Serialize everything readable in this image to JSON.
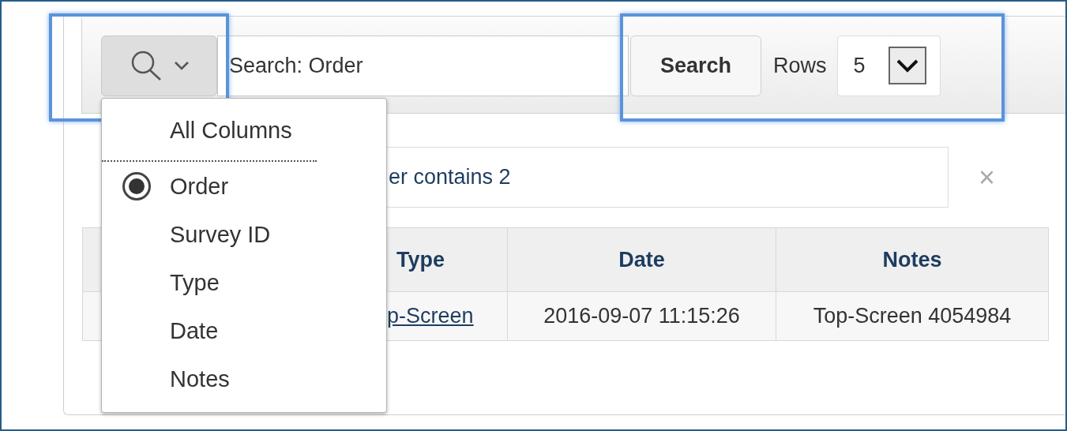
{
  "toolbar": {
    "column_button": {
      "expanded": true
    },
    "search_field": {
      "placeholder": "Search: Order"
    },
    "search_button": "Search",
    "rows": {
      "label": "Rows",
      "value": "5"
    }
  },
  "filter": {
    "text": "er contains 2",
    "close": "×"
  },
  "column_menu": {
    "items": [
      {
        "label": "All Columns",
        "selected": false,
        "divider_after": true
      },
      {
        "label": "Order",
        "selected": true,
        "divider_after": false
      },
      {
        "label": "Survey ID",
        "selected": false,
        "divider_after": false
      },
      {
        "label": "Type",
        "selected": false,
        "divider_after": false
      },
      {
        "label": "Date",
        "selected": false,
        "divider_after": false
      },
      {
        "label": "Notes",
        "selected": false,
        "divider_after": false
      }
    ]
  },
  "table": {
    "columns": [
      "",
      "Type",
      "Date",
      "Notes"
    ],
    "rows": [
      [
        "",
        "p-Screen",
        "2016-09-07 11:15:26",
        "Top-Screen 4054984"
      ]
    ]
  }
}
